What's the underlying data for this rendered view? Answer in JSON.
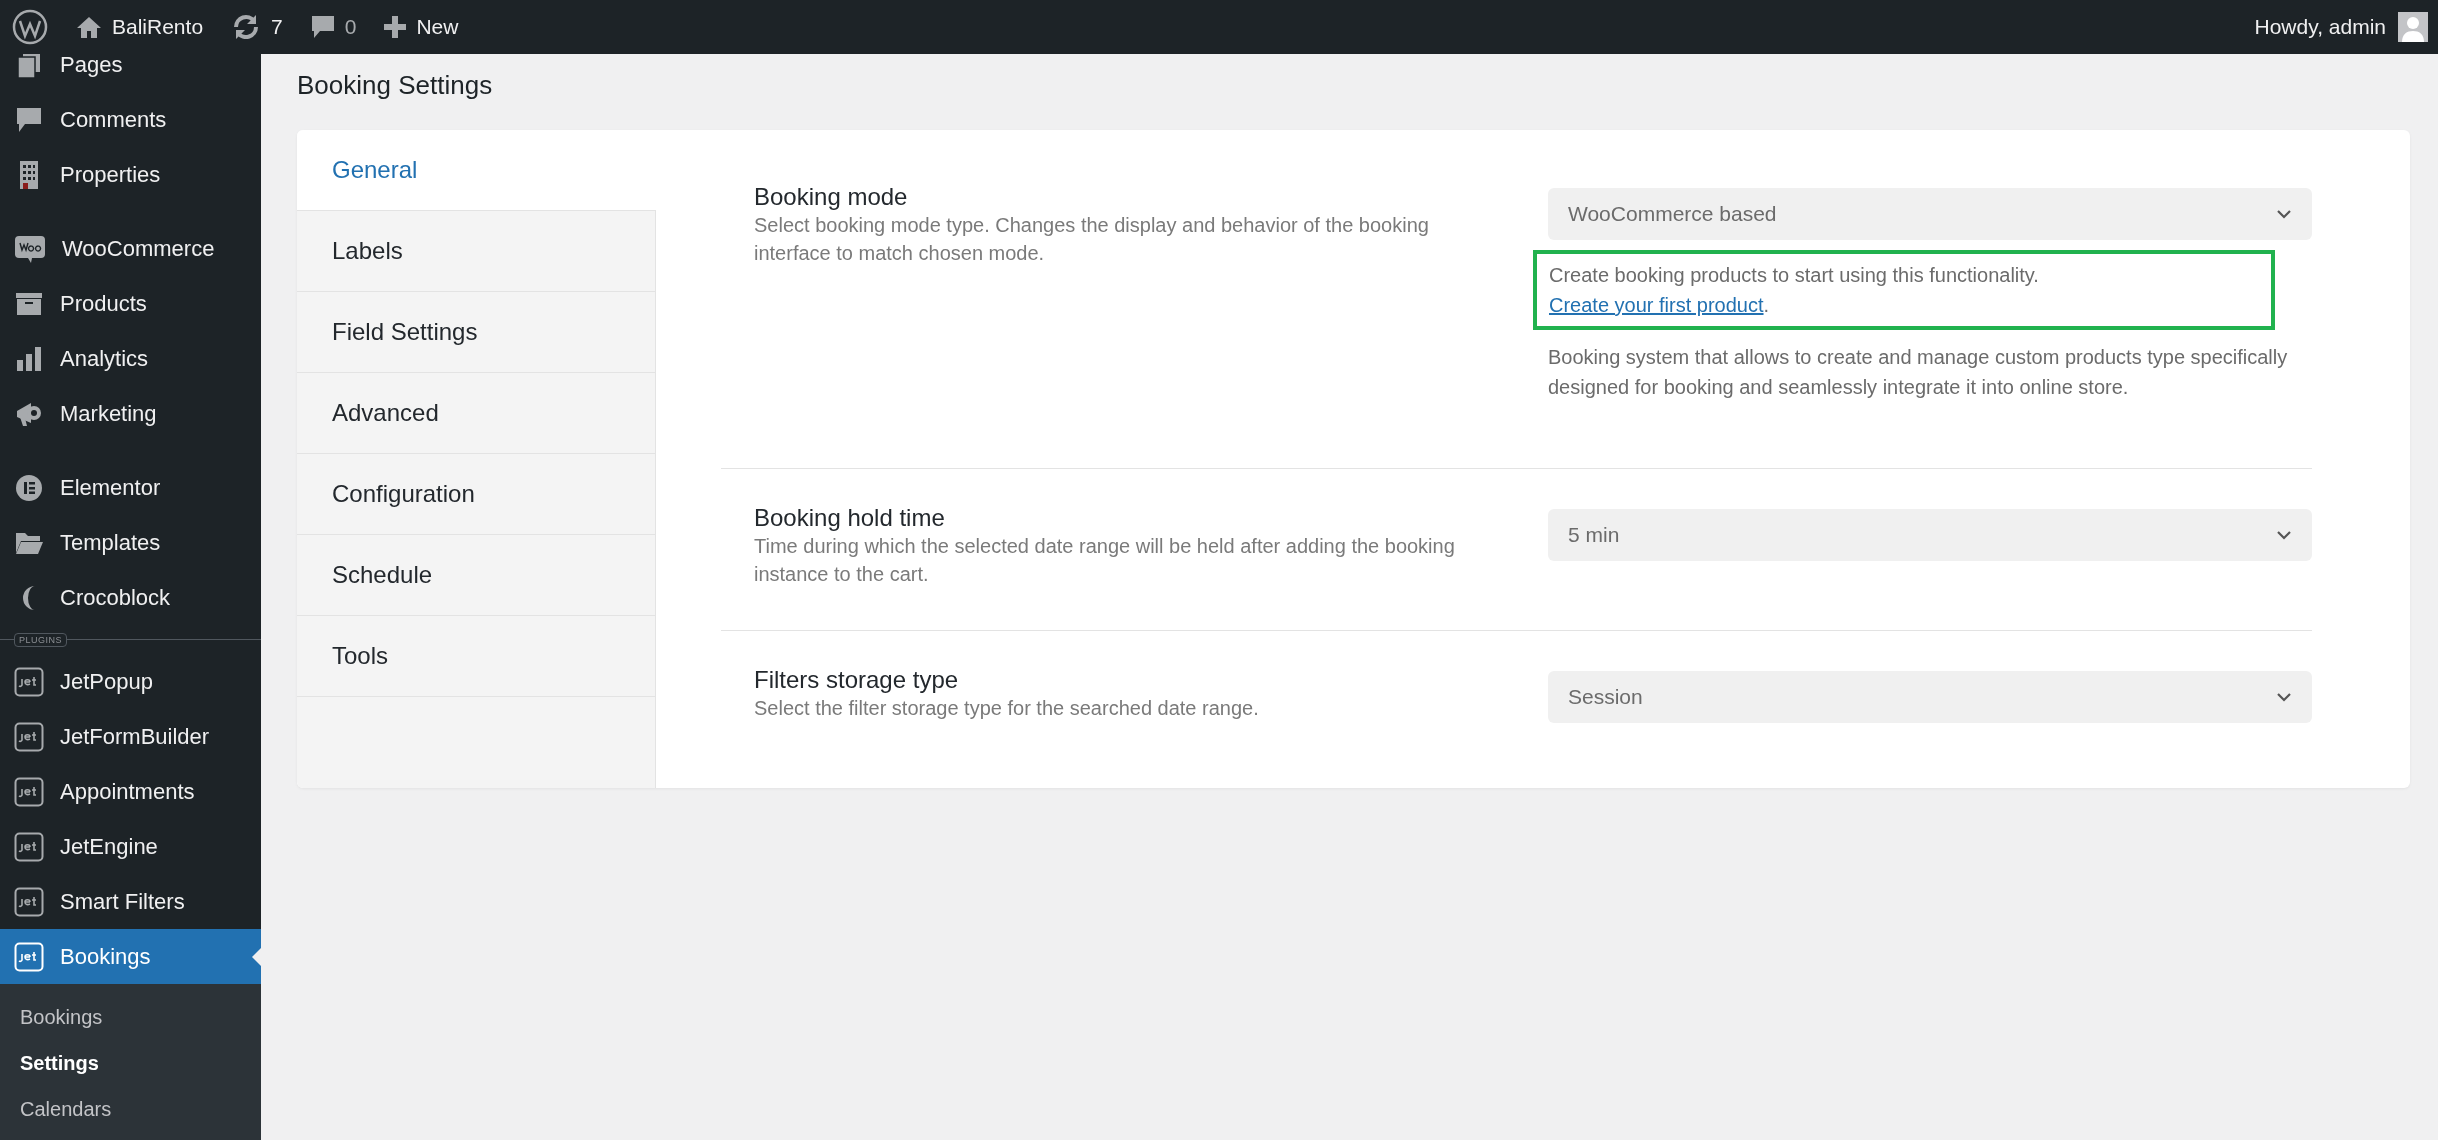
{
  "admin_bar": {
    "site_name": "BaliRento",
    "updates": "7",
    "comments": "0",
    "new": "New",
    "account": "Howdy, admin"
  },
  "sidebar": {
    "items": [
      {
        "kind": "item",
        "label": "Pages",
        "selected": false
      },
      {
        "kind": "item",
        "label": "Comments",
        "selected": false
      },
      {
        "kind": "item",
        "label": "Properties",
        "selected": false
      },
      {
        "kind": "separator"
      },
      {
        "kind": "item",
        "label": "WooCommerce",
        "selected": false
      },
      {
        "kind": "item",
        "label": "Products",
        "selected": false
      },
      {
        "kind": "item",
        "label": "Analytics",
        "selected": false
      },
      {
        "kind": "item",
        "label": "Marketing",
        "selected": false
      },
      {
        "kind": "separator"
      },
      {
        "kind": "item",
        "label": "Elementor",
        "selected": false
      },
      {
        "kind": "item",
        "label": "Templates",
        "selected": false
      },
      {
        "kind": "item",
        "label": "Crocoblock",
        "selected": false
      },
      {
        "kind": "section",
        "label": "PLUGINS"
      },
      {
        "kind": "item",
        "label": "JetPopup",
        "selected": false
      },
      {
        "kind": "item",
        "label": "JetFormBuilder",
        "selected": false
      },
      {
        "kind": "item",
        "label": "Appointments",
        "selected": false
      },
      {
        "kind": "item",
        "label": "JetEngine",
        "selected": false
      },
      {
        "kind": "item",
        "label": "Smart Filters",
        "selected": false
      },
      {
        "kind": "item",
        "label": "Bookings",
        "selected": true,
        "children": [
          {
            "label": "Bookings",
            "selected": false
          },
          {
            "label": "Settings",
            "selected": true
          },
          {
            "label": "Calendars",
            "selected": false
          }
        ]
      }
    ]
  },
  "page_title": "Booking Settings",
  "tabs": [
    {
      "label": "General",
      "selected": true
    },
    {
      "label": "Labels",
      "selected": false
    },
    {
      "label": "Field Settings",
      "selected": false
    },
    {
      "label": "Advanced",
      "selected": false
    },
    {
      "label": "Configuration",
      "selected": false
    },
    {
      "label": "Schedule",
      "selected": false
    },
    {
      "label": "Tools",
      "selected": false
    }
  ],
  "settings": [
    {
      "title": "Booking mode",
      "description": "Select booking mode type. Changes the display and behavior of the booking interface to match chosen mode.",
      "value": "WooCommerce based",
      "notice": {
        "text": "Create booking products to start using this functionality.",
        "link": "Create your first product",
        "after": ".",
        "highlighted": true
      },
      "help": "Booking system that allows to create and manage custom products type specifically designed for booking and seamlessly integrate it into online store."
    },
    {
      "title": "Booking hold time",
      "description": "Time during which the selected date range will be held after adding the booking instance to the cart.",
      "value": "5 min"
    },
    {
      "title": "Filters storage type",
      "description": "Select the filter storage type for the searched date range.",
      "value": "Session"
    }
  ]
}
